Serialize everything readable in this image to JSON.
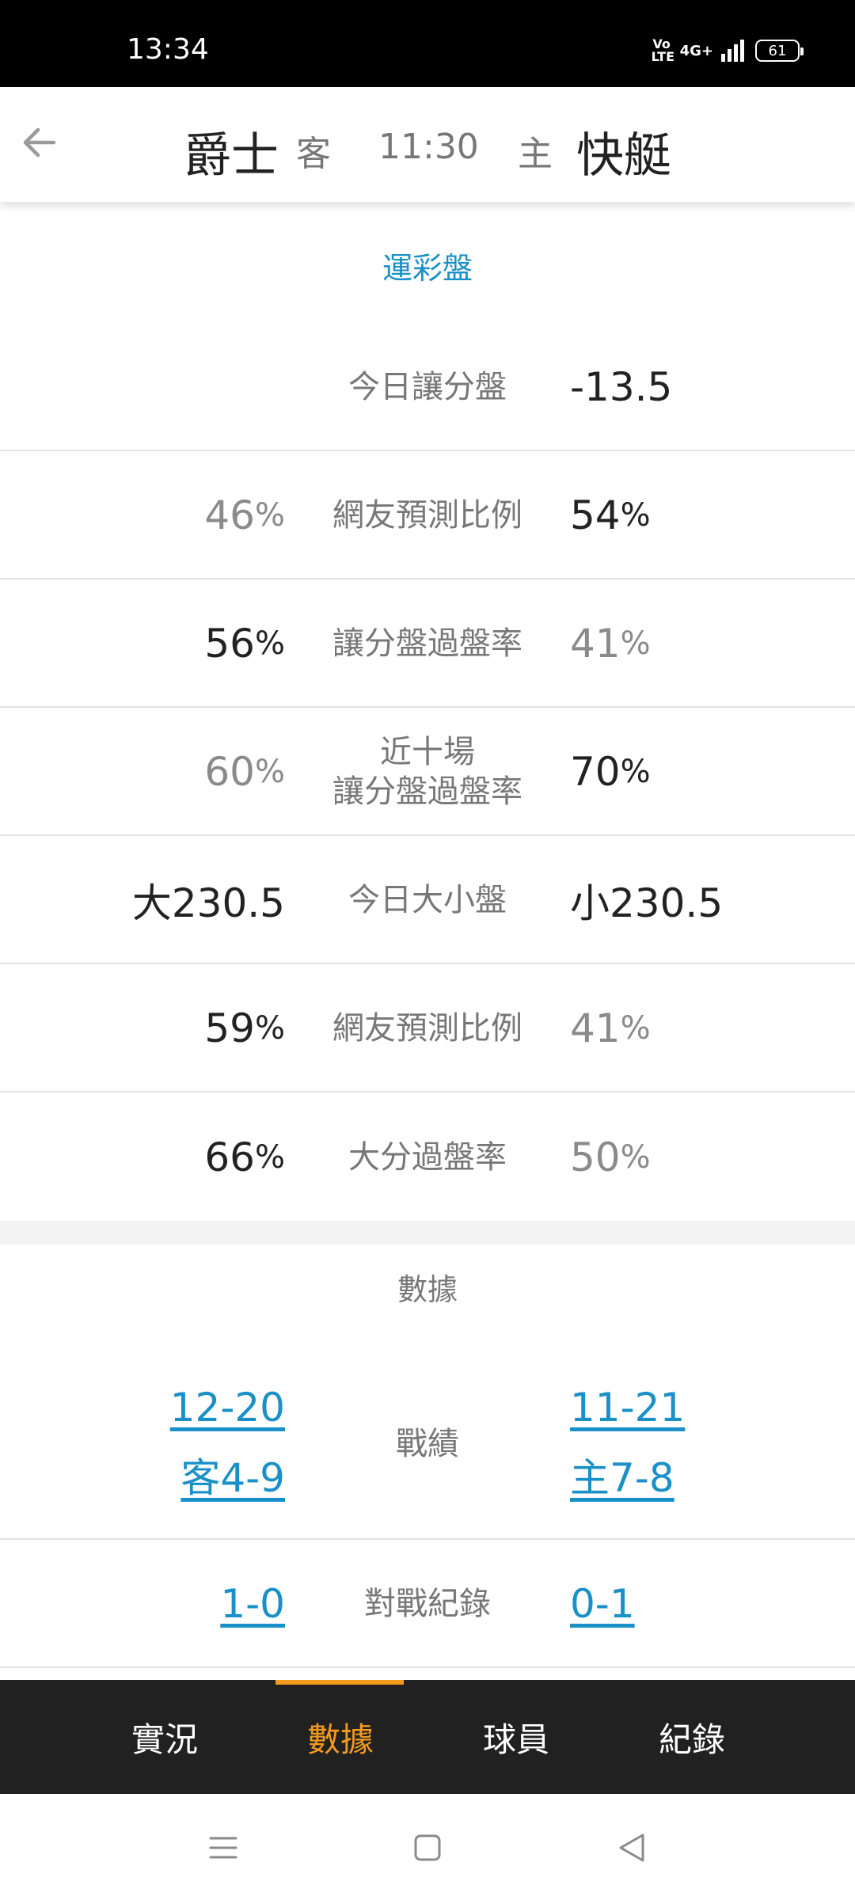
{
  "status_bar": {
    "time": "13:34",
    "volte": "Vo LTE",
    "network": "4G+",
    "battery": "61"
  },
  "header": {
    "away_team": "爵士",
    "away_label": "客",
    "time": "11:30",
    "home_label": "主",
    "home_team": "快艇"
  },
  "odds": {
    "title": "運彩盤",
    "rows": [
      {
        "label": "今日讓分盤",
        "left": "",
        "right": "-13.5"
      },
      {
        "label": "網友預測比例",
        "left_num": "46",
        "left_unit": "%",
        "right_num": "54",
        "right_unit": "%"
      },
      {
        "label": "讓分盤過盤率",
        "left_num": "56",
        "left_unit": "%",
        "right_num": "41",
        "right_unit": "%"
      },
      {
        "label_line1": "近十場",
        "label_line2": "讓分盤過盤率",
        "left_num": "60",
        "left_unit": "%",
        "right_num": "70",
        "right_unit": "%"
      },
      {
        "label": "今日大小盤",
        "left": "大230.5",
        "right": "小230.5"
      },
      {
        "label": "網友預測比例",
        "left_num": "59",
        "left_unit": "%",
        "right_num": "41",
        "right_unit": "%"
      },
      {
        "label": "大分過盤率",
        "left_num": "66",
        "left_unit": "%",
        "right_num": "50",
        "right_unit": "%"
      }
    ]
  },
  "data_section": {
    "title": "數據",
    "record_label": "戰績",
    "away_record": "12-20",
    "away_road": "客4-9",
    "home_record": "11-21",
    "home_home": "主7-8",
    "h2h_label": "對戰紀錄",
    "away_h2h": "1-0",
    "home_h2h": "0-1"
  },
  "tabs": {
    "items": [
      {
        "label": "實況"
      },
      {
        "label": "數據"
      },
      {
        "label": "球員"
      },
      {
        "label": "紀錄"
      }
    ],
    "active_index": 1,
    "active_color": "#f39a1f"
  },
  "colors": {
    "link": "#1a90c8",
    "tab_bg": "#212121"
  }
}
